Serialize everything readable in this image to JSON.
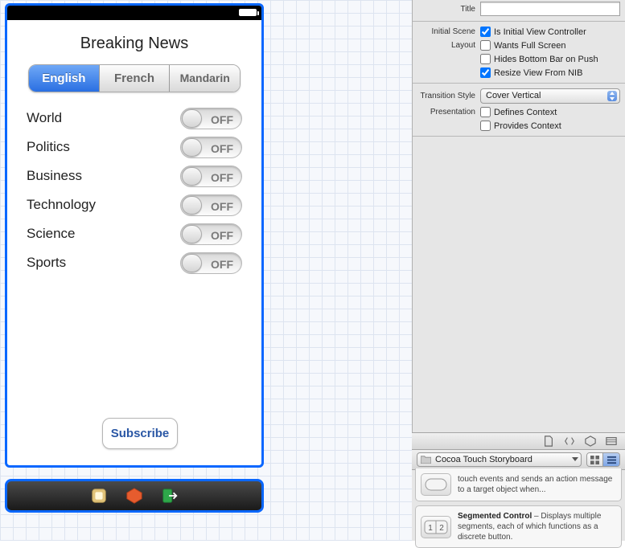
{
  "app": {
    "title": "Breaking News",
    "segments": [
      "English",
      "French",
      "Mandarin"
    ],
    "selected_segment_index": 0,
    "categories": [
      {
        "label": "World",
        "on": false
      },
      {
        "label": "Politics",
        "on": false
      },
      {
        "label": "Business",
        "on": false
      },
      {
        "label": "Technology",
        "on": false
      },
      {
        "label": "Science",
        "on": false
      },
      {
        "label": "Sports",
        "on": false
      }
    ],
    "switch_off_text": "OFF",
    "subscribe_label": "Subscribe"
  },
  "inspector": {
    "title_label": "Title",
    "title_value": "",
    "initial_scene_label": "Initial Scene",
    "is_initial_vc": {
      "label": "Is Initial View Controller",
      "checked": true
    },
    "layout_label": "Layout",
    "wants_full_screen": {
      "label": "Wants Full Screen",
      "checked": false
    },
    "hides_bottom_bar": {
      "label": "Hides Bottom Bar on Push",
      "checked": false
    },
    "resize_from_nib": {
      "label": "Resize View From NIB",
      "checked": true
    },
    "transition_style_label": "Transition Style",
    "transition_style_value": "Cover Vertical",
    "presentation_label": "Presentation",
    "defines_context": {
      "label": "Defines Context",
      "checked": false
    },
    "provides_context": {
      "label": "Provides Context",
      "checked": false
    }
  },
  "library": {
    "filter": "Cocoa Touch Storyboard",
    "items": [
      {
        "title": "",
        "desc": "touch events and sends an action message to a target object when...",
        "thumb": "button"
      },
      {
        "title": "Segmented Control",
        "desc": " – Displays multiple segments, each of which functions as a discrete button.",
        "thumb": "segmented"
      }
    ]
  }
}
